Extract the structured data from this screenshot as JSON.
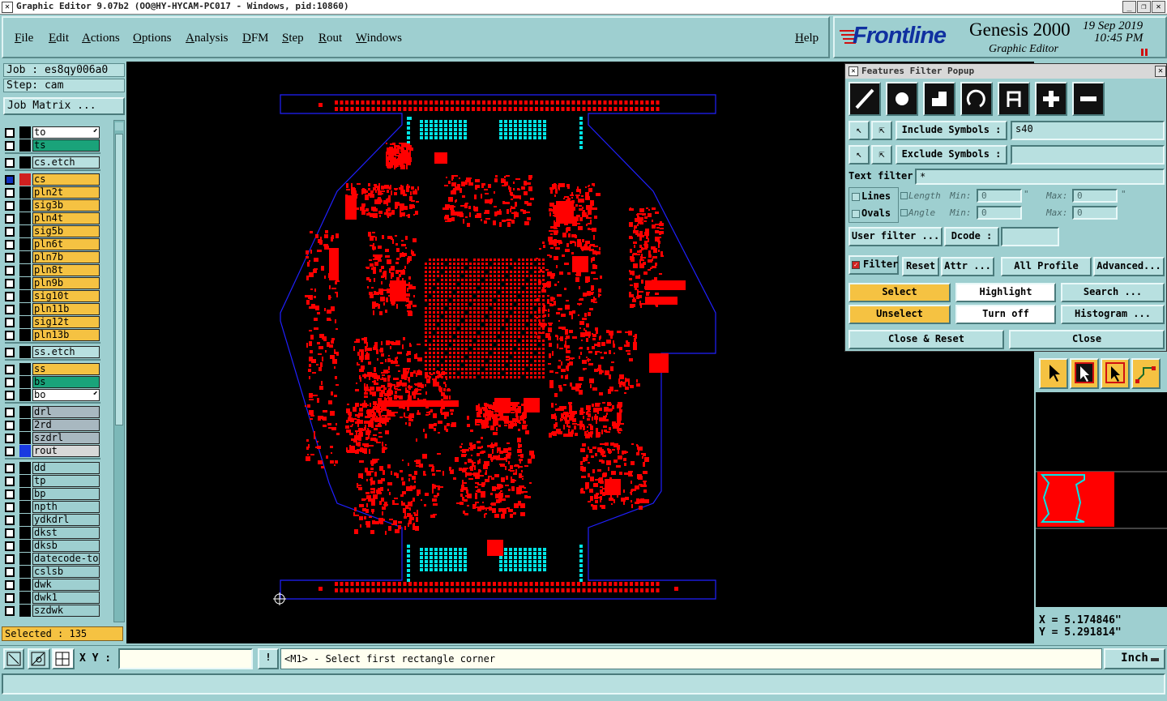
{
  "window": {
    "title": "Graphic Editor 9.07b2 (OO@HY-HYCAM-PC017 - Windows, pid:10860)",
    "min_icon": "_",
    "restore_icon": "❐",
    "close_icon": "✕",
    "app_icon": "✕"
  },
  "menu": {
    "items": [
      "File",
      "Edit",
      "Actions",
      "Options",
      "Analysis",
      "DFM",
      "Step",
      "Rout",
      "Windows"
    ],
    "help": "Help"
  },
  "logo": {
    "brand": "Frontline",
    "product": "Genesis 2000",
    "subtitle": "Graphic Editor",
    "date": "19 Sep 2019",
    "time": "10:45 PM"
  },
  "job": {
    "job_label": "Job : es8qy006a0",
    "step_label": "Step: cam",
    "matrix_button": "Job Matrix ..."
  },
  "layers": [
    {
      "name": "to",
      "color": "#ffffff",
      "arrow": "⬋"
    },
    {
      "name": "ts",
      "color": "#1aa37a"
    },
    {
      "name": "cs.etch",
      "color": "#b8e0e0"
    },
    {
      "name": "cs",
      "color": "#f5c242",
      "active": true
    },
    {
      "name": "pln2t",
      "color": "#f5c242"
    },
    {
      "name": "sig3b",
      "color": "#f5c242"
    },
    {
      "name": "pln4t",
      "color": "#f5c242"
    },
    {
      "name": "sig5b",
      "color": "#f5c242"
    },
    {
      "name": "pln6t",
      "color": "#f5c242"
    },
    {
      "name": "pln7b",
      "color": "#f5c242"
    },
    {
      "name": "pln8t",
      "color": "#f5c242"
    },
    {
      "name": "pln9b",
      "color": "#f5c242"
    },
    {
      "name": "sig10t",
      "color": "#f5c242"
    },
    {
      "name": "pln11b",
      "color": "#f5c242"
    },
    {
      "name": "sig12t",
      "color": "#f5c242"
    },
    {
      "name": "pln13b",
      "color": "#f5c242"
    },
    {
      "name": "ss.etch",
      "color": "#b8e0e0"
    },
    {
      "name": "ss",
      "color": "#f5c242"
    },
    {
      "name": "bs",
      "color": "#1aa37a"
    },
    {
      "name": "bo",
      "color": "#ffffff",
      "arrow": "⬋"
    },
    {
      "name": "drl",
      "color": "#a8b8c0"
    },
    {
      "name": "2rd",
      "color": "#a8b8c0"
    },
    {
      "name": "szdrl",
      "color": "#a8b8c0"
    },
    {
      "name": "rout",
      "color": "#d8d8d8"
    },
    {
      "name": "dd",
      "color": "#9ecfd0"
    },
    {
      "name": "tp",
      "color": "#9ecfd0"
    },
    {
      "name": "bp",
      "color": "#9ecfd0"
    },
    {
      "name": "npth",
      "color": "#9ecfd0"
    },
    {
      "name": "ydkdrl",
      "color": "#9ecfd0"
    },
    {
      "name": "dkst",
      "color": "#9ecfd0"
    },
    {
      "name": "dksb",
      "color": "#9ecfd0"
    },
    {
      "name": "datecode-to",
      "color": "#9ecfd0"
    },
    {
      "name": "cslsb",
      "color": "#9ecfd0"
    },
    {
      "name": "dwk",
      "color": "#9ecfd0"
    },
    {
      "name": "dwk1",
      "color": "#9ecfd0"
    },
    {
      "name": "szdwk",
      "color": "#9ecfd0"
    }
  ],
  "selected_label": "Selected : 135",
  "filter": {
    "title": "Features Filter Popup",
    "include_label": "Include Symbols :",
    "include_value": "s40",
    "exclude_label": "Exclude Symbols :",
    "exclude_value": "",
    "text_filter_label": "Text filter",
    "text_filter_value": "*",
    "lines_label": "Lines",
    "ovals_label": "Ovals",
    "length_label": "Length",
    "angle_label": "Angle",
    "min_label": "Min:",
    "max_label": "Max:",
    "length_min": "0",
    "length_max": "0",
    "angle_min": "0",
    "angle_max": "0",
    "length_unit": "\"",
    "user_filter": "User filter ...",
    "dcode_label": "Dcode :",
    "dcode_value": "",
    "filter_check": "Filter",
    "reset": "Reset",
    "attr": "Attr ...",
    "all_profile": "All Profile",
    "advanced": "Advanced...",
    "select": "Select",
    "highlight": "Highlight",
    "search": "Search ...",
    "unselect": "Unselect",
    "turn_off": "Turn off",
    "histogram": "Histogram ...",
    "close_reset": "Close & Reset",
    "close": "Close"
  },
  "coords": {
    "x": "X = 5.174846\"",
    "y": "Y = 5.291814\""
  },
  "bottom": {
    "xy_label": "X Y :",
    "xy_value": "",
    "prompt": "<M1> - Select first rectangle corner",
    "unit": "Inch",
    "info_icon": "!"
  },
  "colors": {
    "copper": "#ff0000",
    "profile": "#2020ff",
    "pads": "#00e5e5",
    "panel": "#9ecfd0",
    "highlight": "#f5c242"
  }
}
